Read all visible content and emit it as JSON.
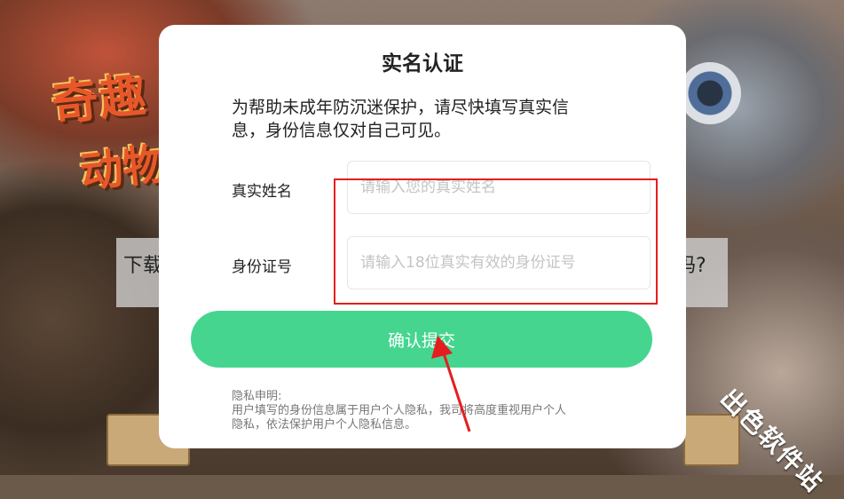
{
  "background": {
    "title_line1": "奇趣",
    "title_line2": "动物",
    "band_left_text": "下载",
    "band_right_text": "吗?"
  },
  "modal": {
    "title": "实名认证",
    "description_line1": "为帮助未成年防沉迷保护，请尽快填写真实信",
    "description_line2": "息，身份信息仅对自己可见。",
    "name_label": "真实姓名",
    "name_placeholder": "请输入您的真实姓名",
    "name_value": "",
    "id_label": "身份证号",
    "id_placeholder": "请输入18位真实有效的身份证号",
    "id_value": "",
    "submit_label": "确认提交",
    "privacy_title": "隐私申明:",
    "privacy_line1": "用户填写的身份信息属于用户个人隐私，我司将高度重视用户个人",
    "privacy_line2": "隐私，依法保护用户个人隐私信息。"
  },
  "watermark": "出色软件站",
  "colors": {
    "accent": "#45d58f",
    "annotation": "#e41e1e"
  }
}
